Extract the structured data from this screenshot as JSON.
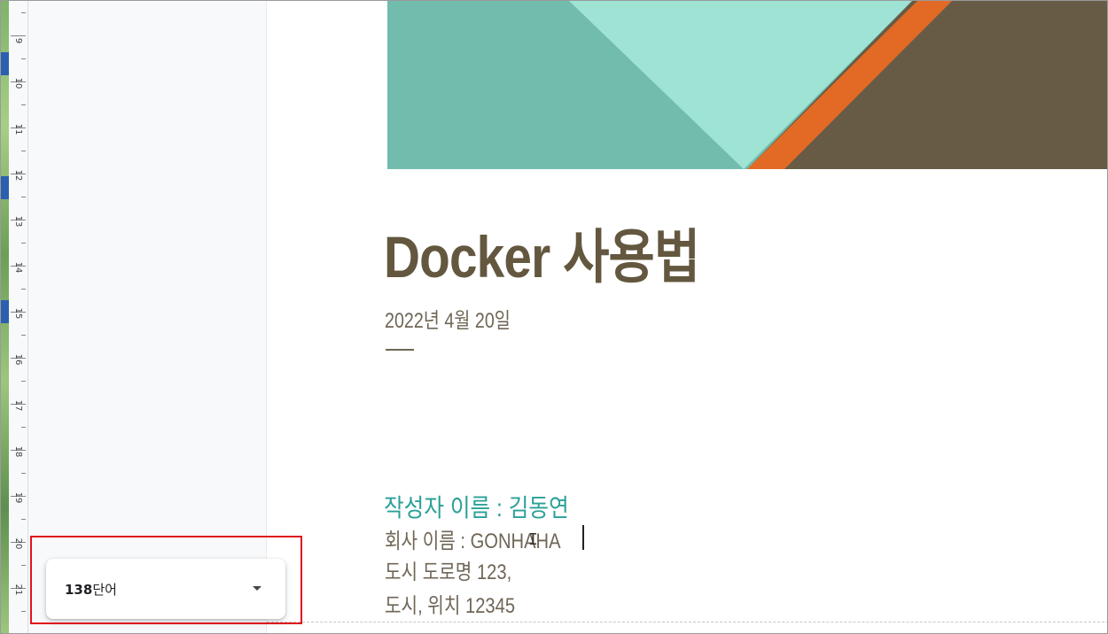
{
  "ruler": {
    "labels": [
      "9",
      "10",
      "11",
      "12",
      "13",
      "14",
      "15",
      "16",
      "17",
      "18",
      "19",
      "20",
      "21"
    ]
  },
  "document": {
    "title": "Docker 사용법",
    "date": "2022년 4월 20일",
    "author_line": "작성자 이름 : 김동연",
    "address_lines": [
      "회사 이름 : GONHAHA",
      "도시 도로명 123,",
      "도시, 위치 12345"
    ]
  },
  "word_count": {
    "number": "138",
    "unit": "단어",
    "dropdown_icon": "triangle-down-icon"
  },
  "colors": {
    "title": "#63573f",
    "author": "#2aa197",
    "body_text": "#6f6656",
    "banner_teal": "#72bcad",
    "banner_mint": "#9fe3d5",
    "banner_orange": "#e26a25",
    "banner_brown": "#675b46",
    "highlight": "#e0141e"
  }
}
